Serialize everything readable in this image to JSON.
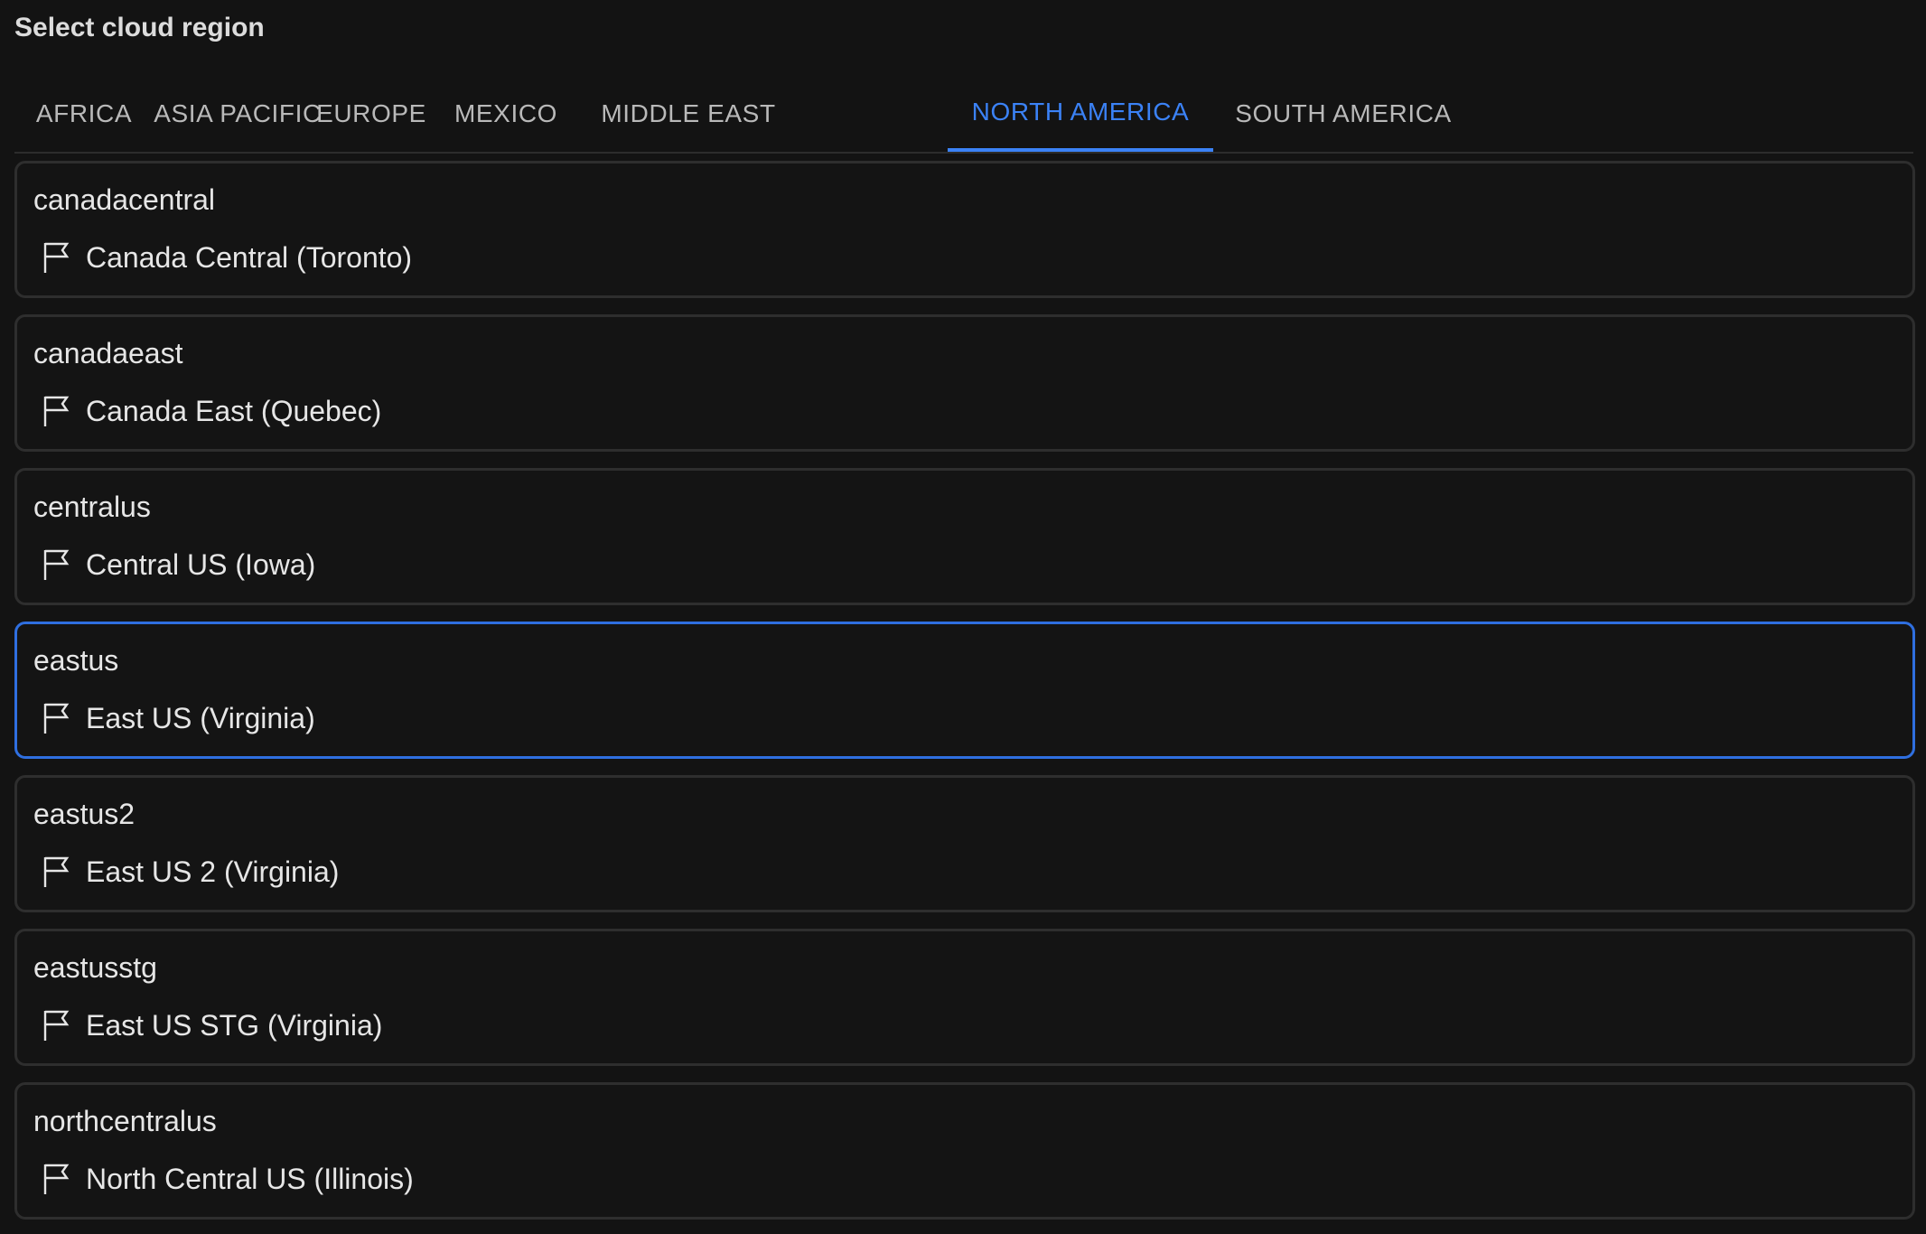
{
  "header": {
    "title": "Select cloud region"
  },
  "tabs": [
    {
      "label": "AFRICA",
      "active": false
    },
    {
      "label": "ASIA PACIFIC",
      "active": false
    },
    {
      "label": "EUROPE",
      "active": false
    },
    {
      "label": "MEXICO",
      "active": false
    },
    {
      "label": "MIDDLE EAST",
      "active": false
    },
    {
      "label": "NORTH AMERICA",
      "active": true
    },
    {
      "label": "SOUTH AMERICA",
      "active": false
    }
  ],
  "regions": [
    {
      "code": "canadacentral",
      "name": "Canada Central (Toronto)",
      "icon": "flag-icon",
      "selected": false
    },
    {
      "code": "canadaeast",
      "name": "Canada East (Quebec)",
      "icon": "flag-icon",
      "selected": false
    },
    {
      "code": "centralus",
      "name": "Central US (Iowa)",
      "icon": "flag-icon",
      "selected": false
    },
    {
      "code": "eastus",
      "name": "East US (Virginia)",
      "icon": "flag-icon",
      "selected": true
    },
    {
      "code": "eastus2",
      "name": "East US 2 (Virginia)",
      "icon": "flag-icon",
      "selected": false
    },
    {
      "code": "eastusstg",
      "name": "East US STG (Virginia)",
      "icon": "flag-icon",
      "selected": false
    },
    {
      "code": "northcentralus",
      "name": "North Central US (Illinois)",
      "icon": "flag-icon",
      "selected": false
    }
  ],
  "colors": {
    "accent": "#3b82f6",
    "background": "#131313",
    "card_border": "#2e2e2e",
    "tab_text": "#b9b9b9"
  }
}
